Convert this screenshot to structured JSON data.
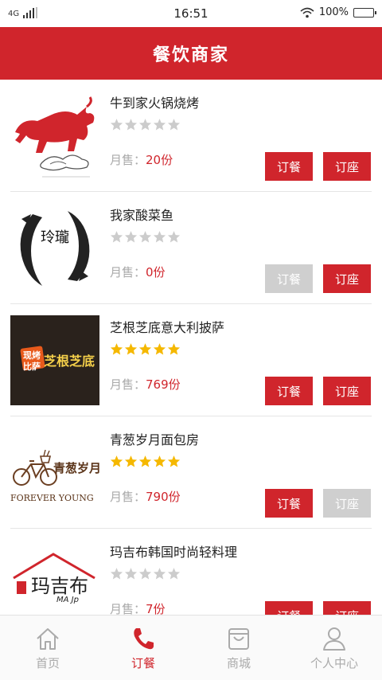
{
  "status_bar": {
    "network": "4G",
    "time": "16:51",
    "battery": "100%",
    "battery_level": 1.0
  },
  "header": {
    "title": "餐饮商家"
  },
  "sales_label": "月售：",
  "restaurants": [
    {
      "name": "牛到家火锅烧烤",
      "rating": 0,
      "sales": "20份",
      "order_label": "订餐",
      "seat_label": "订座",
      "order_enabled": true,
      "seat_enabled": true,
      "logo_icon": "red-bull-logo"
    },
    {
      "name": "我家酸菜鱼",
      "rating": 0,
      "sales": "0份",
      "order_label": "订餐",
      "seat_label": "订座",
      "order_enabled": false,
      "seat_enabled": true,
      "logo_icon": "koi-fish-logo",
      "logo_text": "玲瓏"
    },
    {
      "name": "芝根芝底意大利披萨",
      "rating": 5,
      "sales": "769份",
      "order_label": "订餐",
      "seat_label": "订座",
      "order_enabled": true,
      "seat_enabled": true,
      "logo_icon": "pizza-logo",
      "logo_text_a": "现烤",
      "logo_text_b": "比萨",
      "logo_text_c": "芝根芝底"
    },
    {
      "name": "青葱岁月面包房",
      "rating": 5,
      "sales": "790份",
      "order_label": "订餐",
      "seat_label": "订座",
      "order_enabled": true,
      "seat_enabled": false,
      "logo_icon": "bicycle-logo",
      "logo_text_a": "青葱岁月",
      "logo_text_b": "FOREVER YOUNG"
    },
    {
      "name": "玛吉布韩国时尚轻料理",
      "rating": 0,
      "sales": "7份",
      "order_label": "订餐",
      "seat_label": "订座",
      "order_enabled": true,
      "seat_enabled": true,
      "logo_icon": "house-roof-logo",
      "logo_text_a": "玛吉布",
      "logo_text_b": "MA Jp"
    }
  ],
  "colors": {
    "brand": "#d0252c",
    "star_on": "#f5b800",
    "star_off": "#cccccc",
    "button_disabled": "#cfcfcf"
  },
  "tabs": [
    {
      "label": "首页",
      "icon": "home-icon",
      "active": false
    },
    {
      "label": "订餐",
      "icon": "phone-icon",
      "active": true
    },
    {
      "label": "商城",
      "icon": "shop-bag-icon",
      "active": false
    },
    {
      "label": "个人中心",
      "icon": "user-icon",
      "active": false
    }
  ]
}
